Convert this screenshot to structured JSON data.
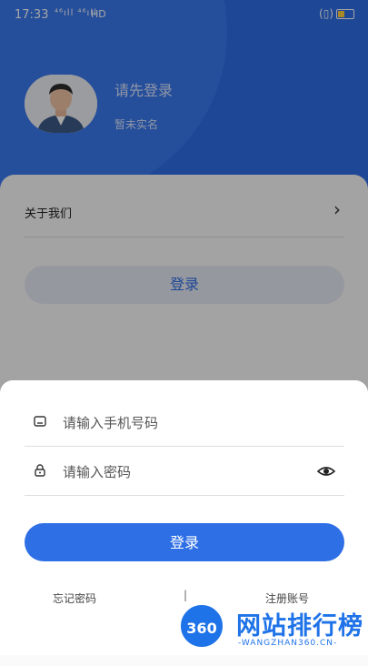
{
  "status_bar": {
    "time": "17:33",
    "signal": "⁴⁶ıll ⁴⁶ıll",
    "network": "HD"
  },
  "profile": {
    "login_prompt": "请先登录",
    "verification_status": "暂未实名"
  },
  "menu": {
    "about_label": "关于我们",
    "background_login_label": "登录"
  },
  "login_form": {
    "phone_placeholder": "请输入手机号码",
    "password_placeholder": "请输入密码",
    "submit_label": "登录",
    "forgot_password_label": "忘记密码",
    "separator": "|",
    "register_label": "注册账号"
  },
  "watermark": {
    "logo_text": "360",
    "title": "网站排行榜",
    "subtitle": "-WANGZHAN360.CN-"
  },
  "colors": {
    "primary": "#2f6fe6",
    "battery": "#ffd23b"
  }
}
